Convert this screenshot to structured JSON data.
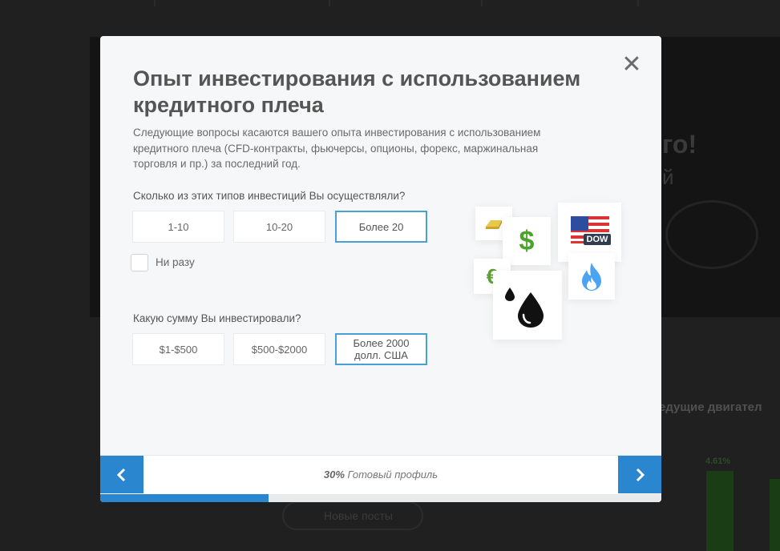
{
  "background": {
    "headline": "го!",
    "sub": "й",
    "section_title": "едущие двигател",
    "bar_label": "4.61%",
    "pill_label": "Новые посты"
  },
  "modal": {
    "title": "Опыт инвестирования с использованием кредитного плеча",
    "subtitle": "Следующие вопросы касаются вашего опыта инвестирования с использованием кредитного плеча (CFD-контракты, фьючерсы, опционы, форекс, маржинальная торговля и пр.) за последний год.",
    "close_icon": "close-icon",
    "q1": {
      "text": "Сколько из этих типов инвестиций Вы осуществляли?",
      "options": [
        "1-10",
        "10-20",
        "Более 20"
      ],
      "selected_index": 2,
      "checkbox_label": "Ни разу",
      "checkbox_checked": false
    },
    "q2": {
      "text": "Какую сумму Вы инвестировали?",
      "options": [
        "$1-$500",
        "$500-$2000",
        "Более 2000 долл. США"
      ],
      "selected_index": 2
    },
    "illustration": {
      "dollar_symbol": "$",
      "euro_symbol": "€",
      "index_badge": "DOW",
      "icons": [
        "gold-bar-icon",
        "dollar-icon",
        "us-flag-icon",
        "euro-icon",
        "oil-drop-icon",
        "gas-flame-icon"
      ]
    },
    "footer": {
      "progress_percent": "30%",
      "progress_label": "Готовый профиль",
      "progress_value": 0.3,
      "prev_icon": "chevron-left-icon",
      "next_icon": "chevron-right-icon"
    }
  },
  "colors": {
    "accent": "#2a86cf",
    "selected_border": "#4a9fd6",
    "dollar_green": "#4aa32a",
    "flame_blue": "#4ba3f3",
    "title_text": "#555555"
  }
}
